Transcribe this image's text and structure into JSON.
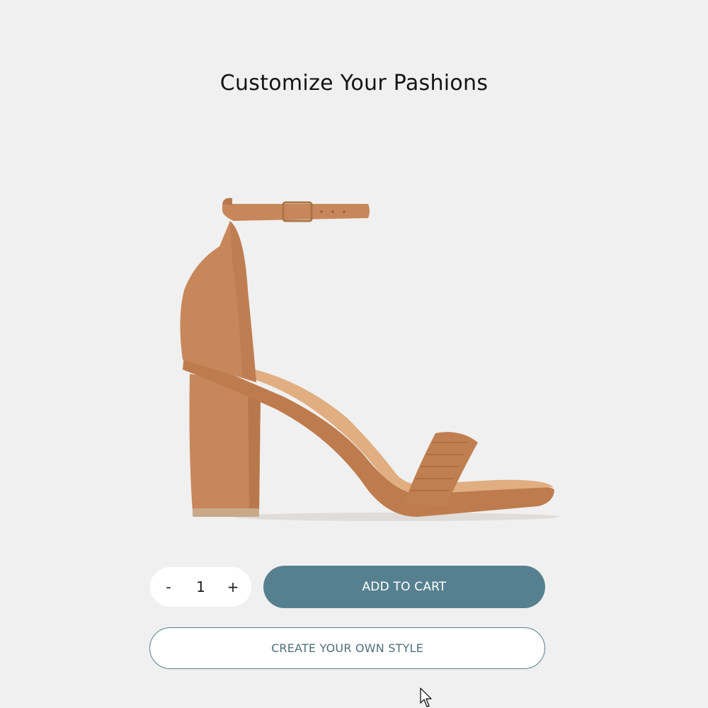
{
  "header": {
    "title": "Customize Your Pashions"
  },
  "product": {
    "image_icon": "sandal-heel-image",
    "color": "#c98a5c"
  },
  "quantity": {
    "minus_label": "-",
    "value": "1",
    "plus_label": "+"
  },
  "actions": {
    "add_to_cart_label": "ADD TO CART",
    "create_style_label": "CREATE YOUR OWN STYLE"
  },
  "colors": {
    "accent": "#56808f",
    "background": "#f0f0f0"
  }
}
